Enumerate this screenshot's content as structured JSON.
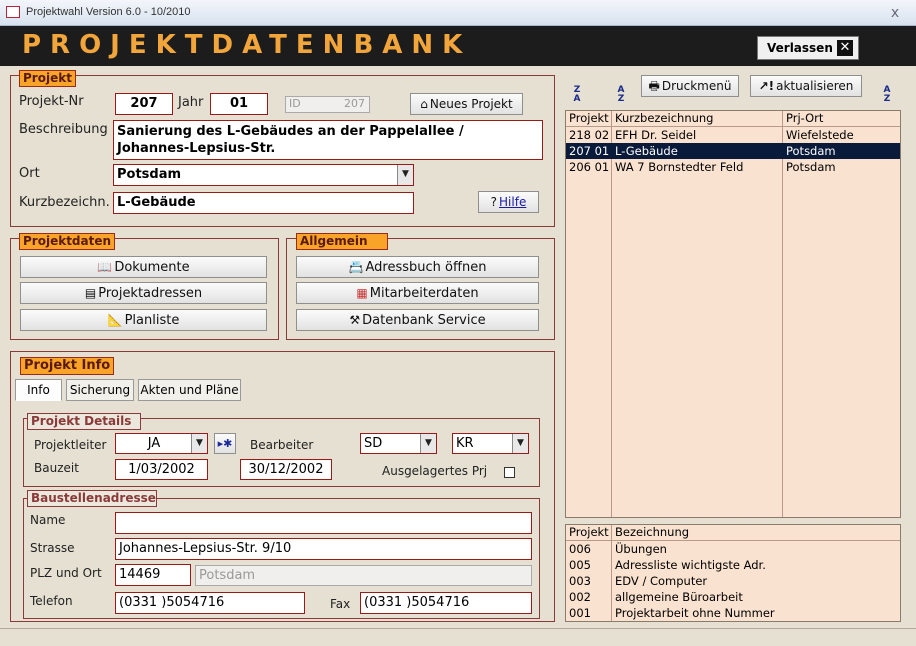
{
  "window": {
    "title": "Projektwahl Version 6.0  - 10/2010",
    "close": "x"
  },
  "header": {
    "title": "PROJEKTDATENBANK",
    "exit_label": "Verlassen",
    "exit_icon": "close-icon"
  },
  "projekt": {
    "group_title": "Projekt",
    "nr_label": "Projekt-Nr",
    "nr_value": "207",
    "jahr_label": "Jahr",
    "jahr_value": "01",
    "id_label": "ID",
    "id_value": "207",
    "new_button": "Neues Projekt",
    "beschreibung_label": "Beschreibung",
    "beschreibung_value": "Sanierung des L-Gebäudes an der Pappelallee / Johannes-Lepsius-Str.",
    "ort_label": "Ort",
    "ort_value": "Potsdam",
    "kurz_label": "Kurzbezeichn.",
    "kurz_value": "L-Gebäude",
    "help_button": "Hilfe"
  },
  "projektdaten": {
    "group_title": "Projektdaten",
    "buttons": [
      "Dokumente",
      "Projektadressen",
      "Planliste"
    ]
  },
  "allgemein": {
    "group_title": "Allgemein",
    "buttons": [
      "Adressbuch öffnen",
      "Mitarbeiterdaten",
      "Datenbank Service"
    ]
  },
  "info": {
    "group_title": "Projekt Info",
    "tabs": [
      "Info",
      "Sicherung",
      "Akten und Pläne"
    ],
    "details": {
      "title": "Projekt Details",
      "leiter_label": "Projektleiter",
      "leiter_value": "JA",
      "bearbeiter_label": "Bearbeiter",
      "bearbeiter1": "SD",
      "bearbeiter2": "KR",
      "bauzeit_label": "Bauzeit",
      "bauzeit_start": "1/03/2002",
      "bauzeit_end": "30/12/2002",
      "ausgelagert_label": "Ausgelagertes Prj"
    },
    "address": {
      "title": "Baustellenadresse",
      "name_label": "Name",
      "name_value": "",
      "strasse_label": "Strasse",
      "strasse_value": "Johannes-Lepsius-Str. 9/10",
      "plz_label": "PLZ und Ort",
      "plz_value": "14469",
      "ort_value": "Potsdam",
      "telefon_label": "Telefon",
      "telefon_value": "(0331 )5054716",
      "fax_label": "Fax",
      "fax_value": "(0331 )5054716"
    }
  },
  "toolbar": {
    "print_label": "Druckmenü",
    "refresh_label": "aktualisieren"
  },
  "project_list": {
    "headers": [
      "Projekt",
      "Kurzbezeichnung",
      "Prj-Ort"
    ],
    "rows": [
      [
        "218 02",
        "EFH Dr. Seidel",
        "Wiefelstede"
      ],
      [
        "207 01",
        "L-Gebäude",
        "Potsdam"
      ],
      [
        "206 01",
        "WA 7 Bornstedter Feld",
        "Potsdam"
      ]
    ],
    "selected_index": 1
  },
  "category_list": {
    "headers": [
      "Projekt",
      "Bezeichnung"
    ],
    "rows": [
      [
        "006",
        "Übungen"
      ],
      [
        "005",
        "Adressliste wichtigste Adr."
      ],
      [
        "003",
        "EDV / Computer"
      ],
      [
        "002",
        "allgemeine Büroarbeit"
      ],
      [
        "001",
        "Projektarbeit ohne Nummer"
      ]
    ]
  },
  "colors": {
    "accent": "#f9a328",
    "header_bg": "#1c1c1c",
    "list_bg": "#f9e2cf",
    "selected_row": "#0a1a3a"
  }
}
